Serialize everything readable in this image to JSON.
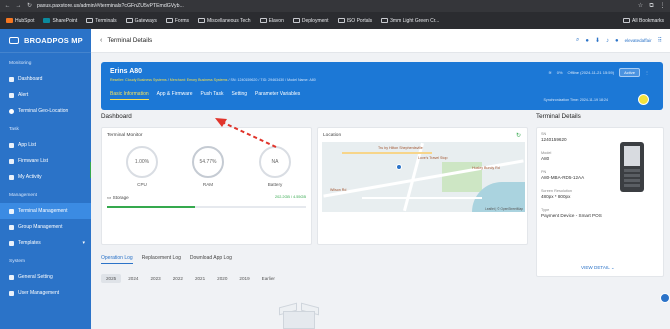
{
  "browser": {
    "url": "paxus.paxstore.us/admin/#/terminals?cGFnZU5vPTEmdGVyb..."
  },
  "bookmarks": [
    {
      "label": "HubSpot"
    },
    {
      "label": "SharePoint"
    },
    {
      "label": "Terminals"
    },
    {
      "label": "Gateways"
    },
    {
      "label": "Forms"
    },
    {
      "label": "Miscellaneous Tech"
    },
    {
      "label": "Elavon"
    },
    {
      "label": "Deployment"
    },
    {
      "label": "ISO Portals"
    },
    {
      "label": "3mm Light Green Cr..."
    },
    {
      "label": "All Bookmarks"
    }
  ],
  "sidebar": {
    "brand": "BROADPOS MP",
    "sections": [
      {
        "title": "Monitoring",
        "items": [
          {
            "label": "Dashboard"
          },
          {
            "label": "Alert"
          },
          {
            "label": "Terminal Geo-Location"
          }
        ]
      },
      {
        "title": "Task",
        "items": [
          {
            "label": "App List"
          },
          {
            "label": "Firmware List"
          },
          {
            "label": "My Activity"
          }
        ]
      },
      {
        "title": "Management",
        "items": [
          {
            "label": "Terminal Management"
          },
          {
            "label": "Group Management"
          },
          {
            "label": "Templates"
          }
        ]
      },
      {
        "title": "System",
        "items": [
          {
            "label": "General Setting"
          },
          {
            "label": "User Management"
          }
        ]
      }
    ]
  },
  "topbar": {
    "title": "Terminal Details",
    "user": "elevatedaffair"
  },
  "hero": {
    "name": "Erins A80",
    "reseller": "Reseller: Cloudy Business Systems",
    "merchant": "Merchant: Emory Business Systems",
    "sn": "SN: 1240159620",
    "tid": "TID: 29463430",
    "model": "Model Name: A80",
    "signal": "0%",
    "offline": "Offline (2024-11-21 15:59)",
    "status": "Active",
    "sync": "Synchronization Time: 2024-11-19 18:24",
    "tabs": [
      "Basic Information",
      "App & Firmware",
      "Push Task",
      "Setting",
      "Parameter Variables"
    ]
  },
  "dashboard": {
    "title": "Dashboard",
    "monitor_title": "Terminal Monitor",
    "cpu": "1.00%",
    "cpu_label": "CPU",
    "ram": "54.77%",
    "ram_label": "RAM",
    "battery": "NA",
    "battery_label": "Battery",
    "storage_label": "Storage",
    "storage_value": "202.2GB / 4.55GB",
    "storage_fraction": 0.44,
    "location_title": "Location",
    "map_labels": [
      "Tru by Hilton Shepherdsville",
      "Love's Travel Stop",
      "Huxley Bundy Rd",
      "Wilson Rd"
    ],
    "map_attribution": "Leaflet | © OpenStreetMap"
  },
  "logs": {
    "tabs": [
      "Operation Log",
      "Replacement Log",
      "Download App Log"
    ],
    "years": [
      "2025",
      "2024",
      "2023",
      "2022",
      "2021",
      "2020",
      "2019",
      "Earlier"
    ]
  },
  "details": {
    "title": "Terminal Details",
    "fields": [
      {
        "k": "SN",
        "v": "1240159620"
      },
      {
        "k": "Model",
        "v": "A80"
      },
      {
        "k": "PN",
        "v": "A80-MBA-RD5-12AA"
      },
      {
        "k": "Screen Resolution",
        "v": "480px * 800px"
      },
      {
        "k": "Type",
        "v": "Payment Device - Smart POS"
      }
    ],
    "view_detail": "VIEW DETAIL"
  },
  "colors": {
    "sidebar": "#2b73c8",
    "hero": "#1c78d6",
    "accent_yellow": "#f7e35a",
    "arrow": "#e0342b"
  }
}
